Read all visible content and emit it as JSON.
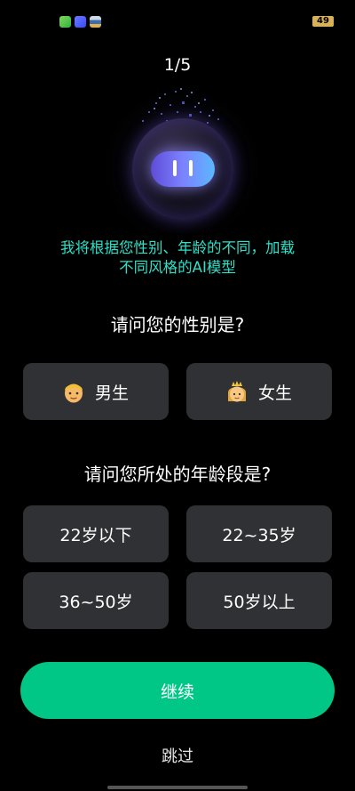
{
  "status_bar": {
    "battery_level": "49",
    "notification_icons": [
      "messaging-app-icon",
      "vpn-app-icon",
      "files-app-icon"
    ]
  },
  "progress": {
    "label": "1/5"
  },
  "intro": {
    "line1": "我将根据您性别、年龄的不同，加载",
    "line2": "不同风格的AI模型"
  },
  "gender_section": {
    "title": "请问您的性别是?",
    "options": [
      {
        "label": "男生",
        "icon": "man-emoji-icon"
      },
      {
        "label": "女生",
        "icon": "princess-emoji-icon"
      }
    ]
  },
  "age_section": {
    "title": "请问您所处的年龄段是?",
    "options": [
      {
        "label": "22岁以下"
      },
      {
        "label": "22~35岁"
      },
      {
        "label": "36~50岁"
      },
      {
        "label": "50岁以上"
      }
    ]
  },
  "actions": {
    "continue_label": "继续",
    "skip_label": "跳过"
  },
  "colors": {
    "background": "#000000",
    "accent_green": "#00c785",
    "intro_text": "#2de0c8",
    "option_background": "#2f3134"
  }
}
